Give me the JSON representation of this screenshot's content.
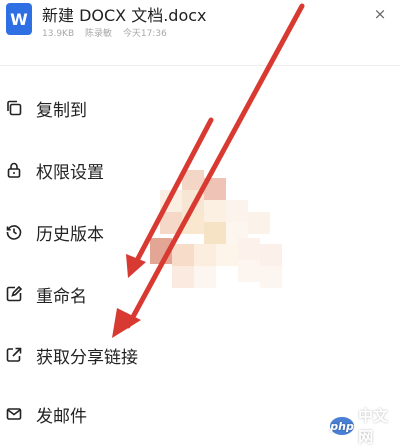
{
  "header": {
    "file_icon_letter": "W",
    "title": "新建 DOCX 文档.docx",
    "meta": {
      "size": "13.9KB",
      "author": "陈录敏",
      "time": "今天17:36"
    },
    "close_glyph": "×"
  },
  "menu": {
    "items": [
      {
        "label": "复制到",
        "icon": "copy-icon"
      },
      {
        "label": "权限设置",
        "icon": "lock-icon"
      },
      {
        "label": "历史版本",
        "icon": "history-icon"
      },
      {
        "label": "重命名",
        "icon": "edit-icon"
      },
      {
        "label": "获取分享链接",
        "icon": "share-link-icon"
      },
      {
        "label": "发邮件",
        "icon": "mail-icon"
      }
    ]
  },
  "annotations": {
    "arrow_color": "#d83a32"
  },
  "watermark": {
    "logo_text": "php",
    "text": "中文网"
  },
  "colors": {
    "brand_blue": "#2f6fe4"
  }
}
